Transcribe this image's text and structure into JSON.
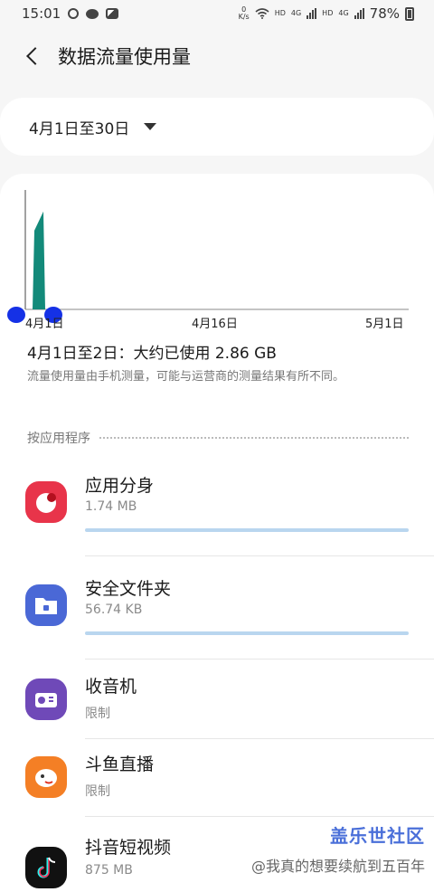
{
  "status": {
    "time": "15:01",
    "net_speed_top": "0",
    "net_speed_unit": "K/s",
    "hd1": "HD",
    "g1": "4G",
    "hd2": "HD",
    "g2": "4G",
    "battery": "78%"
  },
  "header": {
    "title": "数据流量使用量"
  },
  "date_range": {
    "label": "4月1日至30日"
  },
  "chart_data": {
    "type": "area",
    "x_ticks": [
      "4月1日",
      "4月16日",
      "5月1日"
    ],
    "color": "#138a7a",
    "points": [
      {
        "x": "4月1日",
        "y": 0
      },
      {
        "x": "4月1日",
        "y": 0.66
      },
      {
        "x": "4月2日",
        "y": 0.82
      },
      {
        "x": "4月2日",
        "y": 0
      }
    ]
  },
  "summary": {
    "text": "4月1日至2日：大约已使用 2.86 GB"
  },
  "note": {
    "text": "流量使用量由手机测量，可能与运营商的测量结果有所不同。"
  },
  "section": {
    "label": "按应用程序"
  },
  "apps": [
    {
      "name": "应用分身",
      "usage": "1.74 MB",
      "bar": 1.0
    },
    {
      "name": "安全文件夹",
      "usage": "56.74 KB",
      "bar": 1.0
    },
    {
      "name": "收音机",
      "usage": "限制"
    },
    {
      "name": "斗鱼直播",
      "usage": "限制"
    },
    {
      "name": "抖音短视频",
      "usage": "875 MB"
    }
  ],
  "watermark": {
    "logo": "盖乐世社区",
    "text": "@我真的想要续航到五百年"
  }
}
